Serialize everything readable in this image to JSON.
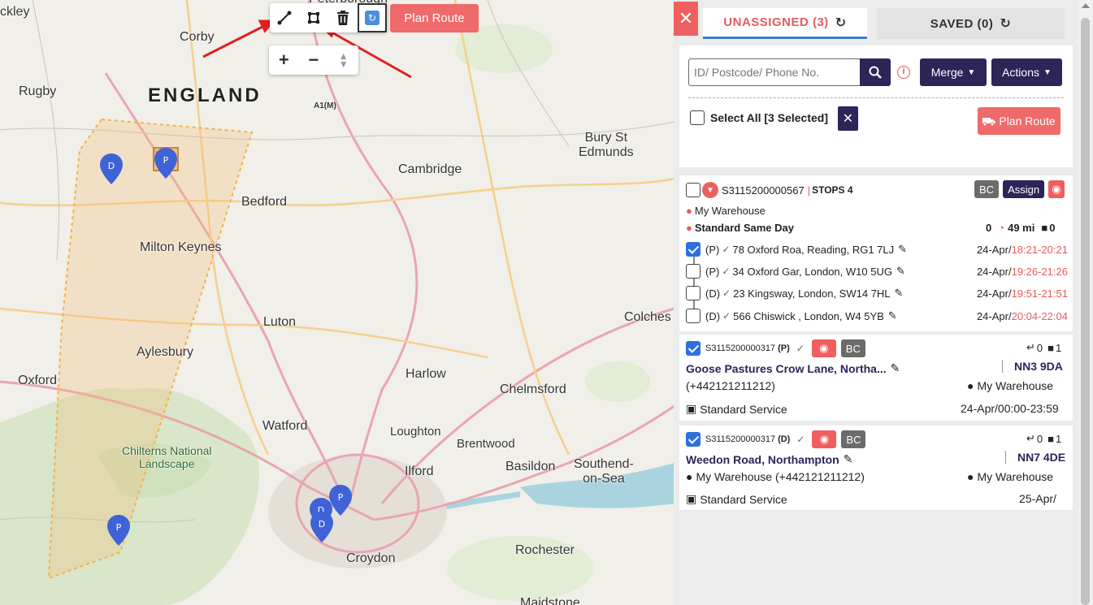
{
  "map": {
    "places": {
      "buckley": "ckley",
      "peterborough": "Peterborough",
      "corby": "Corby",
      "rugby": "Rugby",
      "england": "ENGLAND",
      "a1m": "A1(M)",
      "bury": "Bury St\nEdmunds",
      "cambridge": "Cambridge",
      "bedford": "Bedford",
      "milton_keynes": "Milton Keynes",
      "luton": "Luton",
      "colchester": "Colches",
      "aylesbury": "Aylesbury",
      "harlow": "Harlow",
      "oxford": "Oxford",
      "chelmsford": "Chelmsford",
      "watford": "Watford",
      "loughton": "Loughton",
      "brentwood": "Brentwood",
      "chilterns": "Chilterns National\nLandscape",
      "ilford": "Ilford",
      "basildon": "Basildon",
      "southend": "Southend-\non-Sea",
      "croydon": "Croydon",
      "rochester": "Rochester",
      "maidstone": "Maidstone"
    },
    "pins": {
      "d1": "D",
      "p1": "P",
      "p2": "P",
      "p3": "P",
      "d2": "D",
      "d3": "D"
    },
    "plan_route": "Plan Route",
    "zoom_in": "+",
    "zoom_out": "−"
  },
  "panel": {
    "close": "✕",
    "tabs": {
      "unassigned": "UNASSIGNED (3)",
      "saved": "SAVED (0)"
    },
    "search_placeholder": "ID/ Postcode/ Phone No.",
    "info": "i",
    "merge": "Merge",
    "actions": "Actions",
    "select_all": "Select All [3 Selected]",
    "clear": "✕",
    "plan_route": "Plan Route"
  },
  "route_card": {
    "id": "S3115200000567",
    "stops": "STOPS 4",
    "bc": "BC",
    "assign": "Assign",
    "warehouse": "My Warehouse",
    "service": "Standard Same Day",
    "count": "0",
    "distance": "49 mi",
    "boxes": "0",
    "stops_list": [
      {
        "type": "(P)",
        "addr": "78 Oxford Roa, Reading, RG1 7LJ",
        "date": "24-Apr/",
        "time": "18:21-20:21"
      },
      {
        "type": "(P)",
        "addr": "34 Oxford Gar, London, W10 5UG",
        "date": "24-Apr/",
        "time": "19:26-21:26"
      },
      {
        "type": "(D)",
        "addr": "23 Kingsway, London, SW14 7HL",
        "date": "24-Apr/",
        "time": "19:51-21:51"
      },
      {
        "type": "(D)",
        "addr": "566 Chiswick , London, W4 5YB",
        "date": "24-Apr/",
        "time": "20:04-22:04"
      }
    ]
  },
  "jobs": [
    {
      "id": "S3115200000317",
      "type": "(P)",
      "bc": "BC",
      "count_a": "0",
      "count_b": "1",
      "address": "Goose Pastures Crow Lane, Northa...",
      "postcode": "NN3 9DA",
      "phone": "(+442121211212)",
      "warehouse": "My Warehouse",
      "service": "Standard Service",
      "window": "24-Apr/00:00-23:59"
    },
    {
      "id": "S3115200000317",
      "type": "(D)",
      "bc": "BC",
      "count_a": "0",
      "count_b": "1",
      "address": "Weedon Road, Northampton",
      "postcode": "NN7 4DE",
      "contact": "My Warehouse (+442121211212)",
      "warehouse": "My Warehouse",
      "service": "Standard Service",
      "window": "25-Apr/"
    }
  ],
  "colors": {
    "accent": "#ef5f5f",
    "navy": "#2d2458",
    "blue": "#2d6fe0",
    "pin": "#3f63d6"
  }
}
